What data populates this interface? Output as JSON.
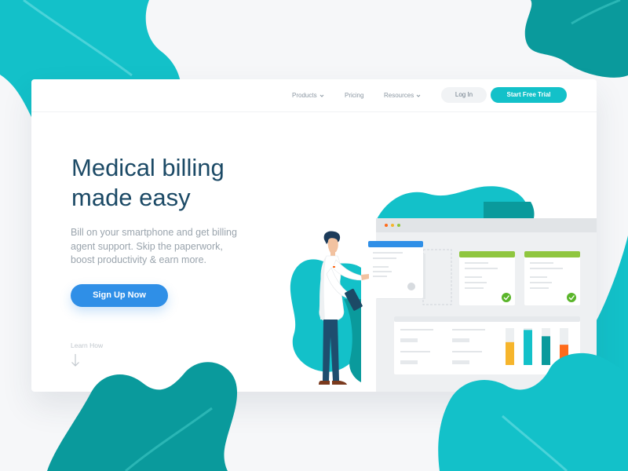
{
  "colors": {
    "teal": "#13c1c9",
    "dark_teal": "#0a9a9c",
    "navy": "#1c4a66",
    "primary_blue": "#2f8fe7",
    "green": "#8fc63f",
    "check_green": "#5ab52a",
    "orange": "#ff6b1a",
    "yellow": "#f6b52c",
    "background": "#f6f7f9"
  },
  "nav": {
    "items": [
      {
        "label": "Products",
        "has_dropdown": true,
        "icon": "chevron-down-icon"
      },
      {
        "label": "Pricing",
        "has_dropdown": false
      },
      {
        "label": "Resources",
        "has_dropdown": true,
        "icon": "chevron-down-icon"
      }
    ],
    "login_label": "Log In",
    "trial_label": "Start Free Trial"
  },
  "hero": {
    "title_line1": "Medical billing",
    "title_line2": "made easy",
    "subtitle_line1": "Bill on your smartphone and get billing",
    "subtitle_line2": "agent support. Skip the paperwork,",
    "subtitle_line3": "boost productivity & earn more.",
    "cta_label": "Sign Up Now",
    "learn_label": "Learn How",
    "learn_icon": "arrow-down-icon"
  },
  "illustration": {
    "subject": "doctor-holding-clipboard",
    "dashboard_window_dots": [
      "#ff6b1a",
      "#f6b52c",
      "#8fc63f"
    ],
    "cards_with_checkmark": 2,
    "mini_bar_chart": {
      "bar_levels": [
        0.62,
        0.95,
        0.78,
        0.55
      ],
      "bar_colors": [
        "#f6b52c",
        "#13c1c9",
        "#0a9a9c",
        "#ff6b1a"
      ]
    }
  }
}
